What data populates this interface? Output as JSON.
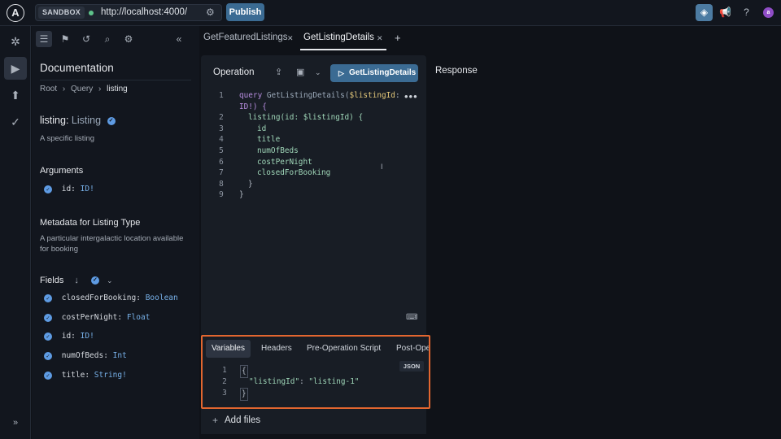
{
  "topbar": {
    "logo": "A",
    "sandbox_label": "SANDBOX",
    "url": "http://localhost:4000/",
    "publish_label": "Publish",
    "avatar_initial": "a"
  },
  "tabs": [
    {
      "label": "GetFeaturedListings"
    },
    {
      "label": "GetListingDetails"
    }
  ],
  "docs": {
    "title": "Documentation",
    "breadcrumb": [
      "Root",
      "Query",
      "listing"
    ],
    "field_name": "listing:",
    "field_type": "Listing",
    "field_desc": "A specific listing",
    "arguments_title": "Arguments",
    "argument": {
      "name": "id:",
      "type": "ID!"
    },
    "metadata_title": "Metadata for Listing Type",
    "metadata_desc": "A particular intergalactic location available for booking",
    "fields_title": "Fields",
    "fields": [
      {
        "name": "closedForBooking:",
        "type": "Boolean"
      },
      {
        "name": "costPerNight:",
        "type": "Float"
      },
      {
        "name": "id:",
        "type": "ID!"
      },
      {
        "name": "numOfBeds:",
        "type": "Int"
      },
      {
        "name": "title:",
        "type": "String!"
      }
    ]
  },
  "operation": {
    "title": "Operation",
    "run_label": "GetListingDetails",
    "lines": [
      {
        "n": "1",
        "kw": "query",
        "fn": " GetListingDetails(",
        "var": "$listingId",
        "rest": ":"
      },
      {
        "n": "",
        "text": "ID!) {"
      },
      {
        "n": "2",
        "text": "listing(id: $listingId) {"
      },
      {
        "n": "3",
        "text": "id"
      },
      {
        "n": "4",
        "text": "title"
      },
      {
        "n": "5",
        "text": "numOfBeds"
      },
      {
        "n": "6",
        "text": "costPerNight"
      },
      {
        "n": "7",
        "text": "closedForBooking"
      },
      {
        "n": "8",
        "text": "}"
      },
      {
        "n": "9",
        "text": "}"
      }
    ]
  },
  "variables": {
    "tabs": [
      "Variables",
      "Headers",
      "Pre-Operation Script",
      "Post-Operation Script"
    ],
    "badge": "JSON",
    "lines": [
      {
        "n": "1",
        "text": "{"
      },
      {
        "n": "2",
        "key": "\"listingId\"",
        "sep": ": ",
        "value": "\"listing-1\""
      },
      {
        "n": "3",
        "text": "}"
      }
    ]
  },
  "add_files_label": "Add files",
  "response_title": "Response"
}
